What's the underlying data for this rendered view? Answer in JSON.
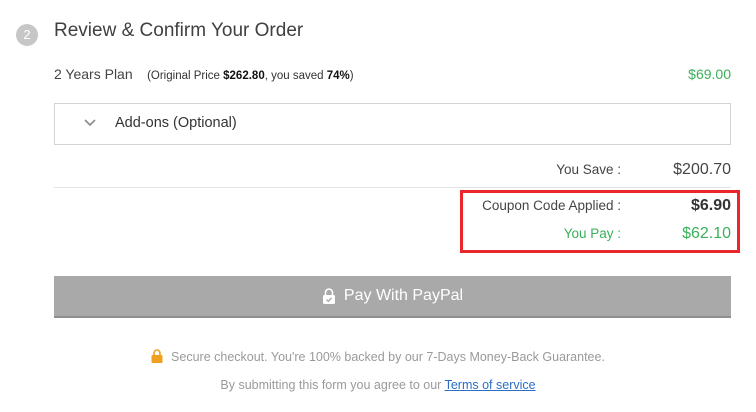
{
  "step": {
    "number": "2",
    "title": "Review & Confirm Your Order"
  },
  "plan": {
    "name": "2 Years Plan",
    "note_prefix": "(Original Price ",
    "original_price": "$262.80",
    "note_middle": ", you saved ",
    "saved_percent": "74%",
    "note_suffix": ")",
    "price": "$69.00"
  },
  "addons": {
    "label": "Add-ons (Optional)",
    "icon": "chevron-down-icon"
  },
  "summary": {
    "you_save_label": "You Save :",
    "you_save_value": "$200.70",
    "coupon_label": "Coupon Code Applied :",
    "coupon_value": "$6.90",
    "you_pay_label": "You Pay :",
    "you_pay_value": "$62.10"
  },
  "pay_button": {
    "label": "Pay With PayPal",
    "icon": "lock-icon"
  },
  "secure_text": "Secure checkout. You're 100% backed by our 7-Days Money-Back Guarantee.",
  "terms": {
    "prefix": "By submitting this form you agree to our ",
    "link": "Terms of service"
  },
  "colors": {
    "accent_green": "#3ab05a",
    "highlight_red": "#e8262c",
    "button_gray": "#a9a9a9",
    "lock_orange": "#f0a020"
  }
}
